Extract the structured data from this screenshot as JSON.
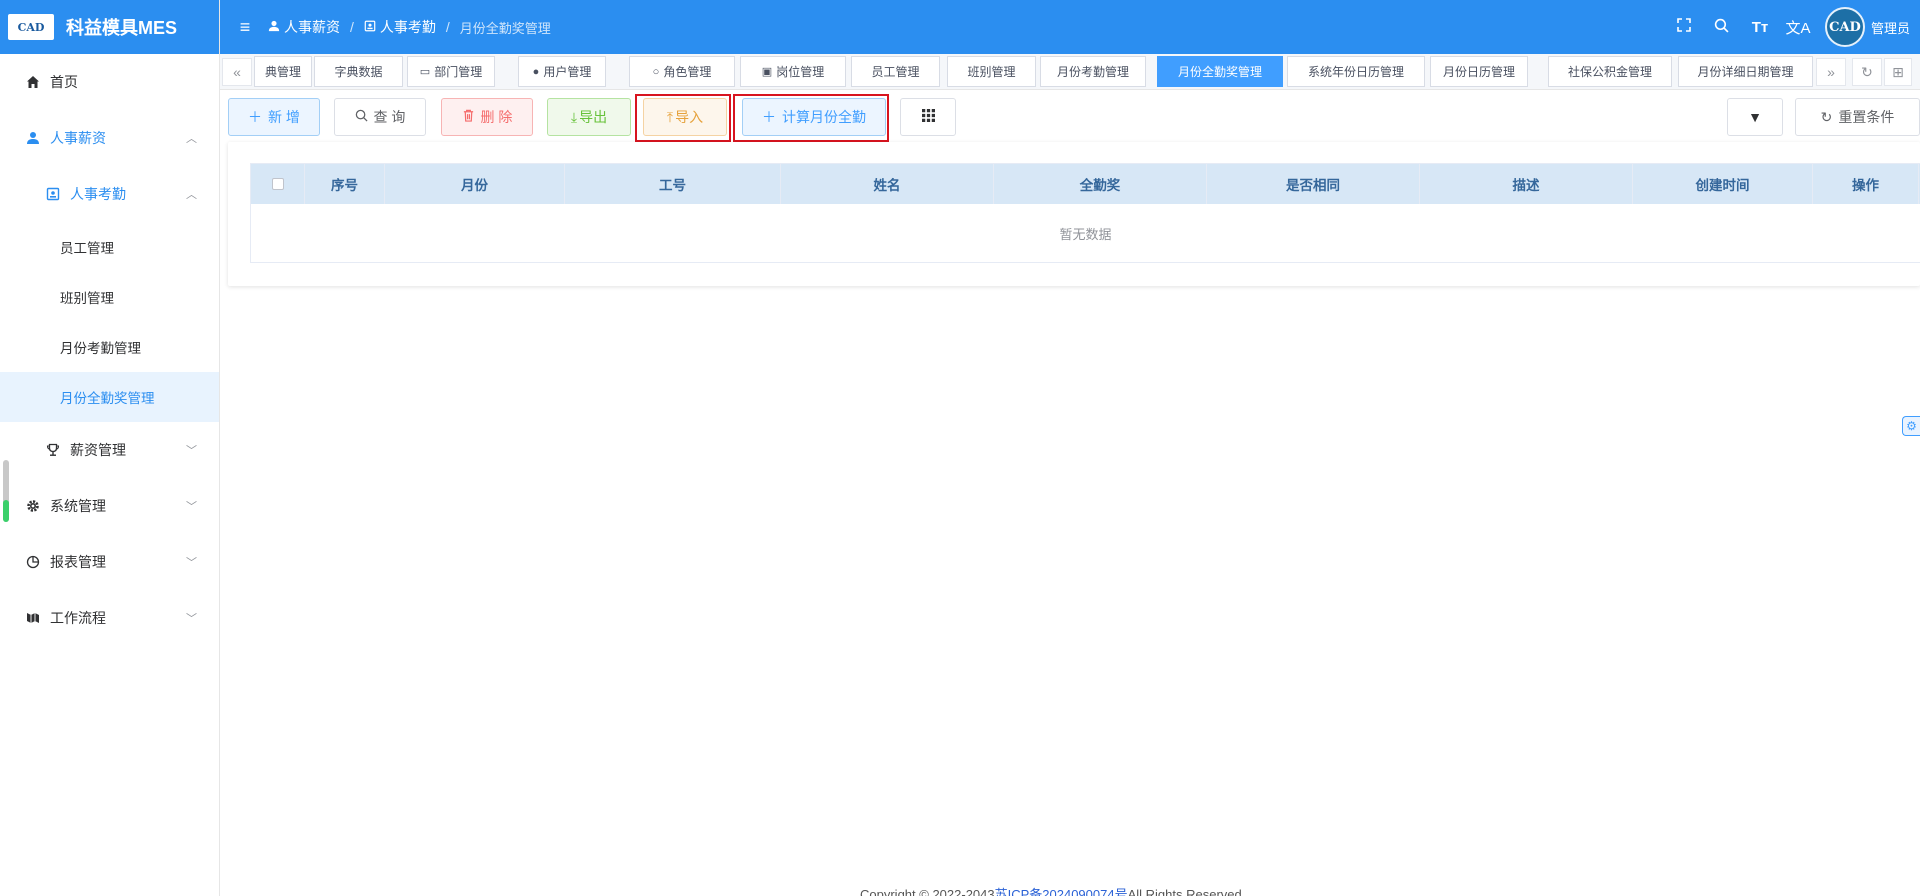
{
  "app": {
    "logo_text": "CAD",
    "title": "科益模具MES"
  },
  "sidebar": {
    "items": [
      {
        "label": "首页",
        "icon": "home-icon"
      },
      {
        "label": "人事薪资",
        "icon": "user-icon"
      },
      {
        "label": "人事考勤",
        "icon": "badge-icon"
      },
      {
        "label": "员工管理"
      },
      {
        "label": "班别管理"
      },
      {
        "label": "月份考勤管理"
      },
      {
        "label": "月份全勤奖管理"
      },
      {
        "label": "薪资管理",
        "icon": "trophy-icon"
      },
      {
        "label": "系统管理",
        "icon": "gear-icon"
      },
      {
        "label": "报表管理",
        "icon": "pie-icon"
      },
      {
        "label": "工作流程",
        "icon": "flow-icon"
      }
    ]
  },
  "header": {
    "breadcrumb": [
      "人事薪资",
      "人事考勤",
      "月份全勤奖管理"
    ],
    "avatar_text": "CAD",
    "username": "管理员"
  },
  "tabs": [
    "典管理",
    "字典数据",
    "部门管理",
    "用户管理",
    "角色管理",
    "岗位管理",
    "员工管理",
    "班别管理",
    "月份考勤管理",
    "月份全勤奖管理",
    "系统年份日历管理",
    "月份日历管理",
    "社保公积金管理",
    "月份详细日期管理"
  ],
  "active_tab": "月份全勤奖管理",
  "toolbar": {
    "add": "新 增",
    "query": "查 询",
    "delete": "删 除",
    "export": "导出",
    "import": "导入",
    "calc": "计算月份全勤",
    "reset": "重置条件"
  },
  "table": {
    "columns": [
      "序号",
      "月份",
      "工号",
      "姓名",
      "全勤奖",
      "是否相同",
      "描述",
      "创建时间",
      "操作"
    ],
    "empty_text": "暂无数据"
  },
  "footer": {
    "prefix": "Copyright © 2022-2043",
    "icp": "苏ICP备2024090074号",
    "suffix": "All Rights Reserved."
  },
  "colors": {
    "primary": "#2b8ef0",
    "highlight_box": "#d8141f"
  }
}
